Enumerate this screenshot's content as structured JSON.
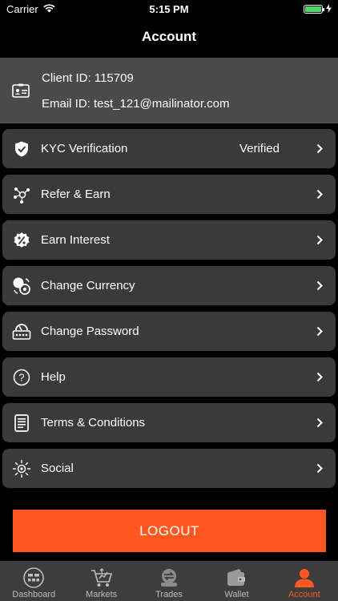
{
  "status_bar": {
    "carrier": "Carrier",
    "time": "5:15 PM"
  },
  "nav": {
    "title": "Account"
  },
  "client": {
    "client_id": "Client ID: 115709",
    "email_id": "Email ID: test_121@mailinator.com"
  },
  "menu": [
    {
      "label": "KYC Verification",
      "status": "Verified",
      "icon": "shield-check-icon"
    },
    {
      "label": "Refer & Earn",
      "icon": "share-nodes-icon"
    },
    {
      "label": "Earn Interest",
      "icon": "percent-badge-icon"
    },
    {
      "label": "Change Currency",
      "icon": "currency-exchange-icon"
    },
    {
      "label": "Change Password",
      "icon": "password-lock-icon"
    },
    {
      "label": "Help",
      "icon": "help-circle-icon"
    },
    {
      "label": "Terms & Conditions",
      "icon": "document-list-icon"
    },
    {
      "label": "Social",
      "icon": "social-sun-icon"
    }
  ],
  "logout_label": "LOGOUT",
  "tabs": [
    {
      "label": "Dashboard",
      "icon": "dashboard-icon"
    },
    {
      "label": "Markets",
      "icon": "markets-cart-icon"
    },
    {
      "label": "Trades",
      "icon": "trades-icon"
    },
    {
      "label": "Wallet",
      "icon": "wallet-icon"
    },
    {
      "label": "Account",
      "icon": "account-user-icon",
      "active": true
    }
  ],
  "colors": {
    "accent": "#ff5722",
    "card": "#3a3a3a",
    "header_card": "#4a4a4a",
    "tab_bar": "#3d3d3d",
    "battery": "#4cd964"
  }
}
